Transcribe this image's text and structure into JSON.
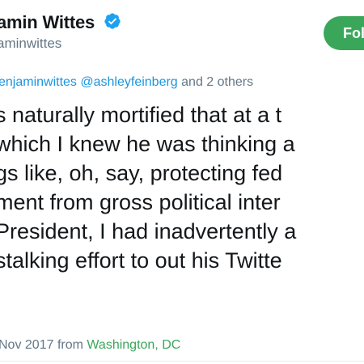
{
  "header": {
    "display_name": "amin Wittes",
    "handle": "aminwittes",
    "follow_label": "Fol"
  },
  "reply": {
    "mention_1": "enjaminwittes",
    "mention_2": "@ashleyfeinberg",
    "others": "and 2 others"
  },
  "tweet": {
    "lines": [
      "s naturally mortified that at a t",
      "which I knew he was thinking a",
      "gs like, oh, say, protecting fed",
      "ment from gross political inter",
      "President, I had inadvertently a",
      "stalking effort to out his Twitte",
      "."
    ]
  },
  "footer": {
    "date": "Nov 2017",
    "from": "from",
    "location": "Washington, DC"
  },
  "colors": {
    "accent_green": "#3aa65a",
    "link_blue": "#1b95e0",
    "verified_blue": "#1da1f2",
    "muted_text": "#657786"
  },
  "icons": {
    "verified": "verified-badge-icon"
  }
}
